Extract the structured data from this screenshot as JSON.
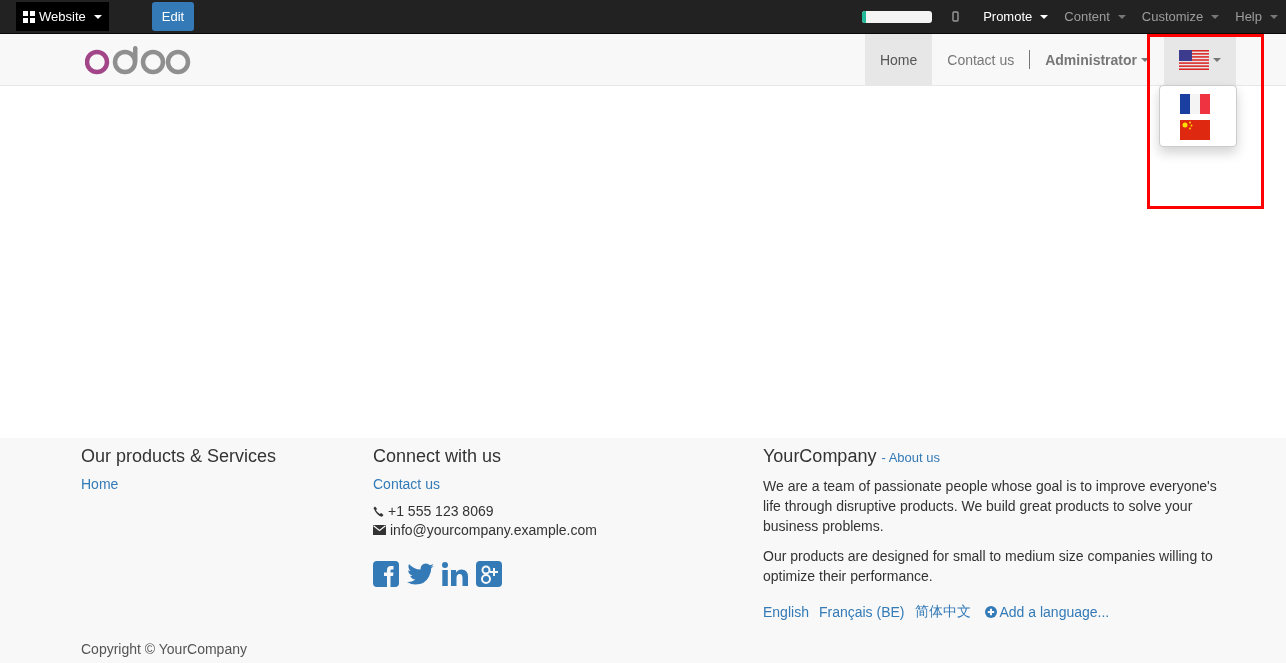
{
  "admin_bar": {
    "apps_menu": "Website",
    "edit_button": "Edit",
    "progress": {
      "level": 0.06
    },
    "menus": [
      {
        "label": "Promote",
        "emphasized": true
      },
      {
        "label": "Content",
        "emphasized": false
      },
      {
        "label": "Customize",
        "emphasized": false
      },
      {
        "label": "Help",
        "emphasized": false
      }
    ]
  },
  "navbar": {
    "items": [
      {
        "label": "Home",
        "selected": true
      },
      {
        "label": "Contact us",
        "selected": false
      }
    ],
    "user_menu": "Administrator",
    "language_menu": {
      "current": {
        "kind": "us"
      },
      "expanded": true,
      "options": [
        {
          "kind": "fr"
        },
        {
          "kind": "cn"
        }
      ]
    }
  },
  "footer": {
    "columns": [
      {
        "heading": "Our products & Services",
        "links": [
          "Home"
        ]
      },
      {
        "heading": "Connect with us",
        "links": [
          "Contact us"
        ],
        "phone": "+1 555 123 8069",
        "email": "info@yourcompany.example.com"
      }
    ],
    "company": {
      "name": "YourCompany",
      "about_link": "- About us",
      "paragraphs": [
        "We are a team of passionate people whose goal is to improve everyone's life through disruptive products. We build great products to solve your business problems.",
        "Our products are designed for small to medium size companies willing to optimize their performance."
      ]
    },
    "languages": [
      "English",
      "Français (BE)",
      "简体中文"
    ],
    "add_language": "Add a language...",
    "copyright": "Copyright © YourCompany"
  }
}
